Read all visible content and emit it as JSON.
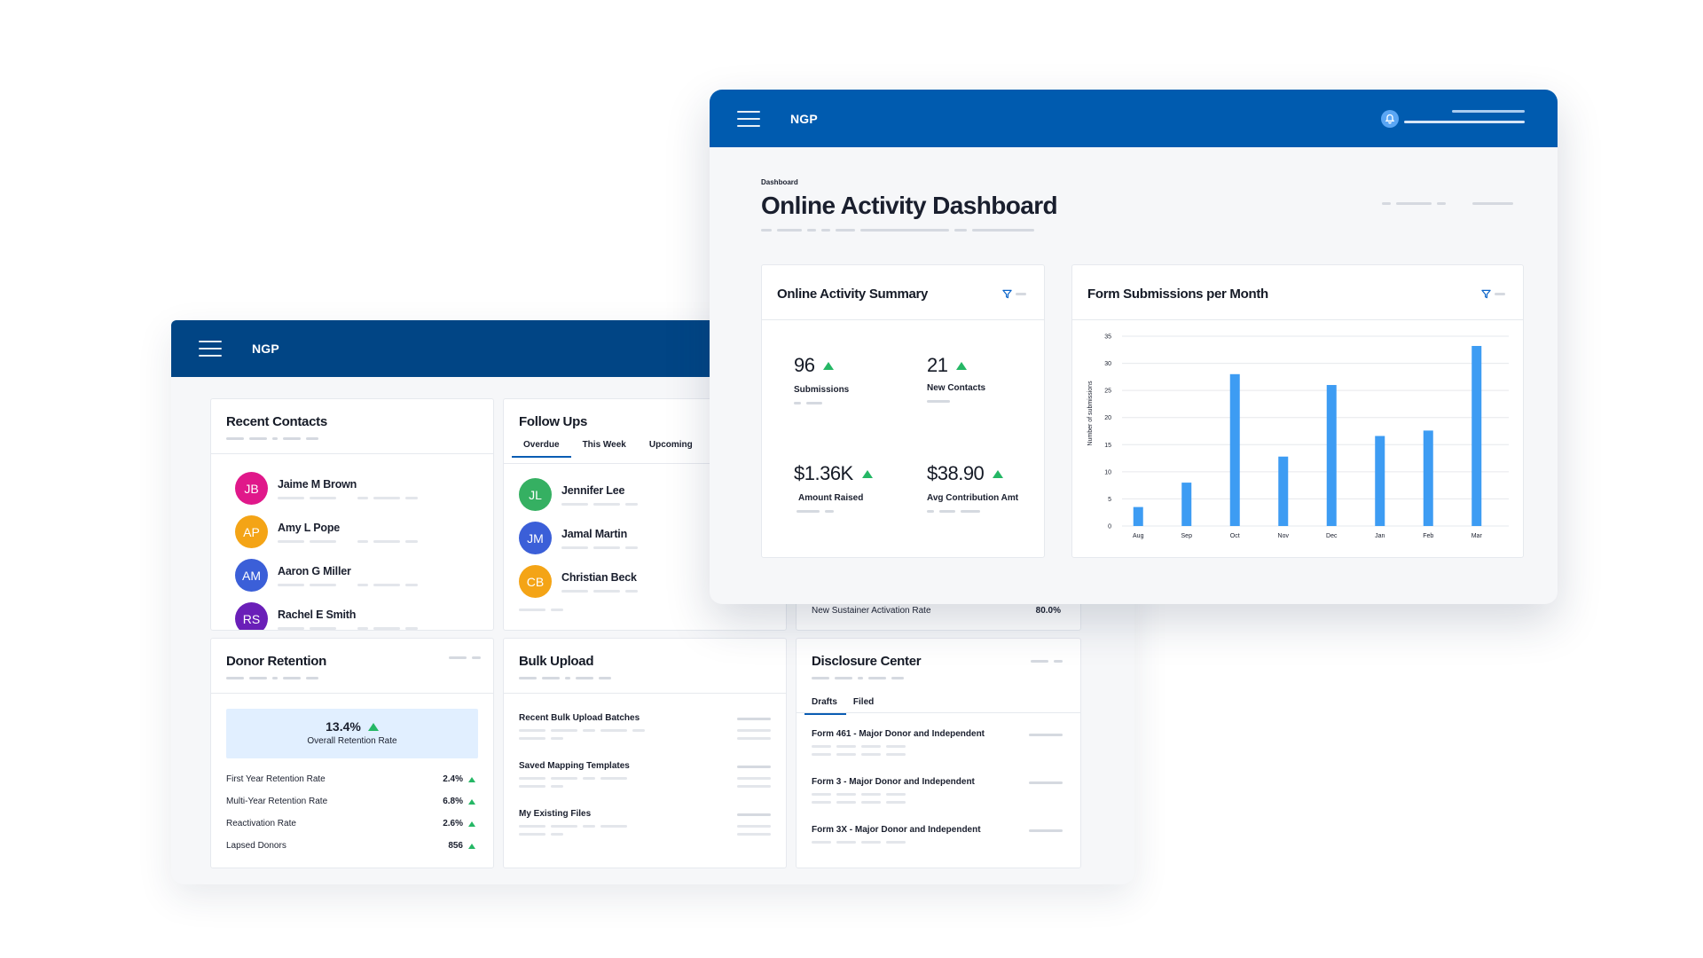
{
  "back_window": {
    "brand": "NGP",
    "recent_contacts": {
      "title": "Recent Contacts",
      "contacts": [
        {
          "initials": "JB",
          "name": "Jaime M Brown",
          "color": "#e0188a"
        },
        {
          "initials": "AP",
          "name": "Amy L Pope",
          "color": "#f4a416"
        },
        {
          "initials": "AM",
          "name": "Aaron G Miller",
          "color": "#3b5fd8"
        },
        {
          "initials": "RS",
          "name": "Rachel E Smith",
          "color": "#6a1fb8"
        }
      ]
    },
    "follow_ups": {
      "title": "Follow Ups",
      "tabs": [
        "Overdue",
        "This Week",
        "Upcoming"
      ],
      "contacts": [
        {
          "initials": "JL",
          "name": "Jennifer Lee",
          "color": "#35b062"
        },
        {
          "initials": "JM",
          "name": "Jamal Martin",
          "color": "#3b5fd8"
        },
        {
          "initials": "CB",
          "name": "Christian Beck",
          "color": "#f4a416"
        }
      ]
    },
    "sustainer": {
      "label": "New Sustainer Activation Rate",
      "value": "80.0%"
    },
    "donor_retention": {
      "title": "Donor Retention",
      "overall_value": "13.4%",
      "overall_label": "Overall Retention Rate",
      "metrics": [
        {
          "label": "First Year Retention Rate",
          "value": "2.4%"
        },
        {
          "label": "Multi-Year Retention Rate",
          "value": "6.8%"
        },
        {
          "label": "Reactivation Rate",
          "value": "2.6%"
        },
        {
          "label": "Lapsed Donors",
          "value": "856"
        }
      ]
    },
    "bulk_upload": {
      "title": "Bulk Upload",
      "items": [
        "Recent Bulk Upload Batches",
        "Saved Mapping Templates",
        "My Existing Files"
      ]
    },
    "disclosure": {
      "title": "Disclosure Center",
      "tabs": [
        "Drafts",
        "Filed"
      ],
      "forms": [
        "Form 461 - Major Donor and Independent",
        "Form 3 - Major Donor and Independent",
        "Form 3X - Major Donor and Independent"
      ]
    }
  },
  "front_window": {
    "brand": "NGP",
    "breadcrumb": "Dashboard",
    "page_title": "Online Activity Dashboard",
    "summary": {
      "title": "Online Activity Summary",
      "kpis": [
        {
          "value": "96",
          "label": "Submissions"
        },
        {
          "value": "21",
          "label": "New Contacts"
        },
        {
          "value": "$1.36K",
          "label": "Amount Raised"
        },
        {
          "value": "$38.90",
          "label": "Avg Contribution Amt"
        }
      ]
    },
    "chart_title": "Form Submissions per Month"
  },
  "colors": {
    "nav_dark": "#014585",
    "nav_blue": "#005baf",
    "bar": "#3d9cf3",
    "up": "#25b765"
  },
  "chart_data": {
    "type": "bar",
    "title": "Form Submissions per Month",
    "xlabel": "",
    "ylabel": "Number of submissions",
    "categories": [
      "Aug",
      "Sep",
      "Oct",
      "Nov",
      "Dec",
      "Jan",
      "Feb",
      "Mar"
    ],
    "values": [
      3.5,
      8,
      28,
      12.8,
      26,
      16.6,
      17.6,
      33.2
    ],
    "ylim": [
      0,
      35
    ],
    "yticks": [
      0,
      5,
      10,
      15,
      20,
      25,
      30,
      35
    ],
    "grid": true
  }
}
